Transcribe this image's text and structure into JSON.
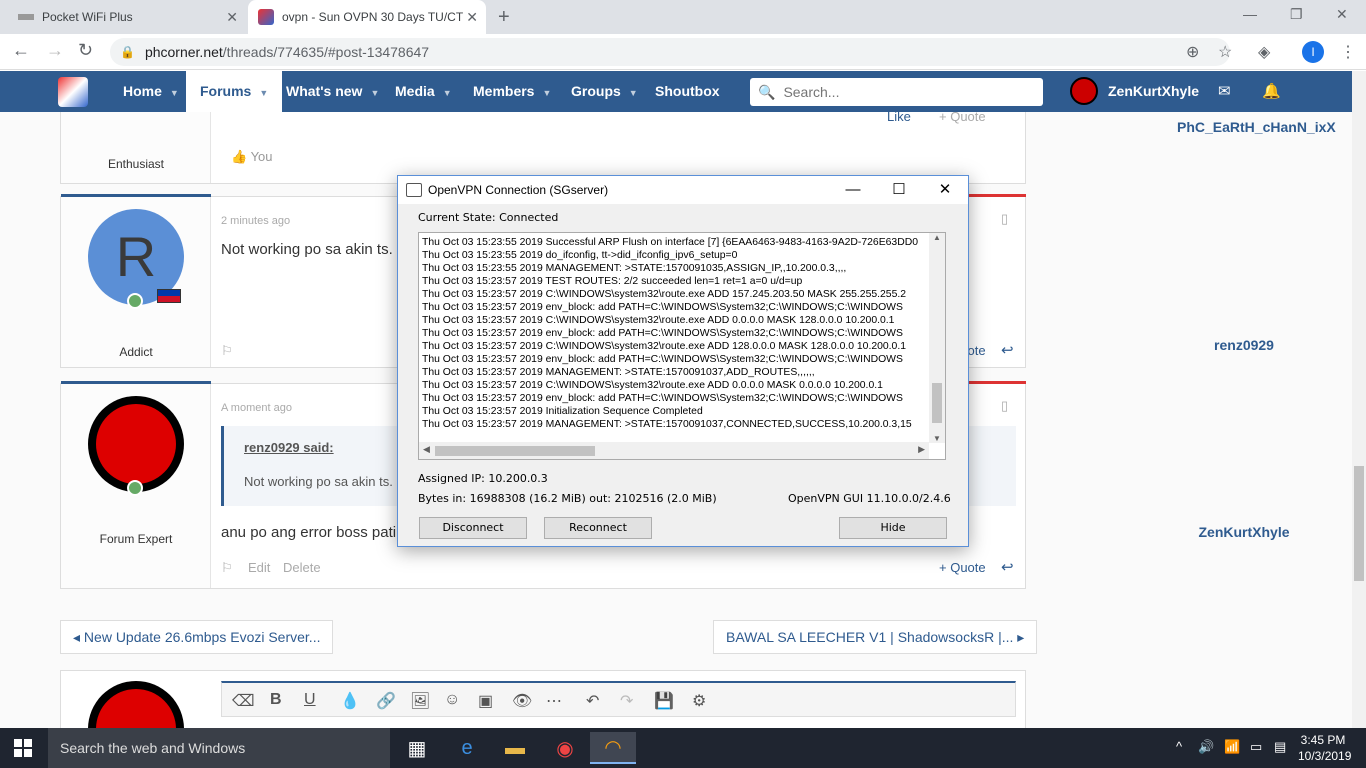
{
  "browser": {
    "tabs": [
      {
        "title": "Pocket WiFi Plus",
        "active": false
      },
      {
        "title": "ovpn - Sun OVPN 30 Days TU/CT",
        "active": true
      }
    ],
    "url_host": "phcorner.net",
    "url_path": "/threads/774635/#post-13478647",
    "profile_initial": "I"
  },
  "site": {
    "nav": [
      {
        "label": "Home"
      },
      {
        "label": "Forums"
      },
      {
        "label": "What's new"
      },
      {
        "label": "Media"
      },
      {
        "label": "Members"
      },
      {
        "label": "Groups"
      },
      {
        "label": "Shoutbox"
      }
    ],
    "search_placeholder": "Search...",
    "current_user": "ZenKurtXhyle"
  },
  "posts": [
    {
      "username": "PhC_EaRtH_cHanN_ixX",
      "title": "Enthusiast",
      "liked_by": "You",
      "actions": [
        "Like",
        "+ Quote"
      ]
    },
    {
      "username": "renz0929",
      "title": "Addict",
      "avatar_letter": "R",
      "time": "2 minutes ago",
      "message": "Not working po sa akin ts.",
      "quote_label": "+ Quote"
    },
    {
      "username": "ZenKurtXhyle",
      "title": "Forum Expert",
      "time": "A moment ago",
      "quoted_user": "renz0929 said:",
      "quoted_text": "Not working po sa akin ts.",
      "message": "anu po ang error boss pati",
      "actions": [
        "Edit",
        "Delete",
        "+ Quote"
      ]
    }
  ],
  "thread_nav": {
    "prev": "New Update 26.6mbps Evozi Server...",
    "next": "BAWAL SA LEECHER V1 | ShadowsocksR |..."
  },
  "vpn_dialog": {
    "title": "OpenVPN Connection (SGserver)",
    "state": "Current State: Connected",
    "log": [
      "Thu Oct 03 15:23:55 2019 Successful ARP Flush on interface [7] {6EAA6463-9483-4163-9A2D-726E63DD0",
      "Thu Oct 03 15:23:55 2019 do_ifconfig, tt->did_ifconfig_ipv6_setup=0",
      "Thu Oct 03 15:23:55 2019 MANAGEMENT: >STATE:1570091035,ASSIGN_IP,,10.200.0.3,,,,",
      "Thu Oct 03 15:23:57 2019 TEST ROUTES: 2/2 succeeded len=1 ret=1 a=0 u/d=up",
      "Thu Oct 03 15:23:57 2019 C:\\WINDOWS\\system32\\route.exe ADD 157.245.203.50 MASK 255.255.255.2",
      "Thu Oct 03 15:23:57 2019 env_block: add PATH=C:\\WINDOWS\\System32;C:\\WINDOWS;C:\\WINDOWS",
      "Thu Oct 03 15:23:57 2019 C:\\WINDOWS\\system32\\route.exe ADD 0.0.0.0 MASK 128.0.0.0 10.200.0.1",
      "Thu Oct 03 15:23:57 2019 env_block: add PATH=C:\\WINDOWS\\System32;C:\\WINDOWS;C:\\WINDOWS",
      "Thu Oct 03 15:23:57 2019 C:\\WINDOWS\\system32\\route.exe ADD 128.0.0.0 MASK 128.0.0.0 10.200.0.1",
      "Thu Oct 03 15:23:57 2019 env_block: add PATH=C:\\WINDOWS\\System32;C:\\WINDOWS;C:\\WINDOWS",
      "Thu Oct 03 15:23:57 2019 MANAGEMENT: >STATE:1570091037,ADD_ROUTES,,,,,,",
      "Thu Oct 03 15:23:57 2019 C:\\WINDOWS\\system32\\route.exe ADD 0.0.0.0 MASK 0.0.0.0 10.200.0.1",
      "Thu Oct 03 15:23:57 2019 env_block: add PATH=C:\\WINDOWS\\System32;C:\\WINDOWS;C:\\WINDOWS",
      "Thu Oct 03 15:23:57 2019 Initialization Sequence Completed",
      "Thu Oct 03 15:23:57 2019 MANAGEMENT: >STATE:1570091037,CONNECTED,SUCCESS,10.200.0.3,15"
    ],
    "assigned_ip": "Assigned IP: 10.200.0.3",
    "bytes": "Bytes in: 16988308 (16.2 MiB)  out: 2102516 (2.0 MiB)",
    "version": "OpenVPN GUI 11.10.0.0/2.4.6",
    "buttons": {
      "disconnect": "Disconnect",
      "reconnect": "Reconnect",
      "hide": "Hide"
    }
  },
  "taskbar": {
    "search": "Search the web and Windows",
    "time": "3:45 PM",
    "date": "10/3/2019"
  }
}
